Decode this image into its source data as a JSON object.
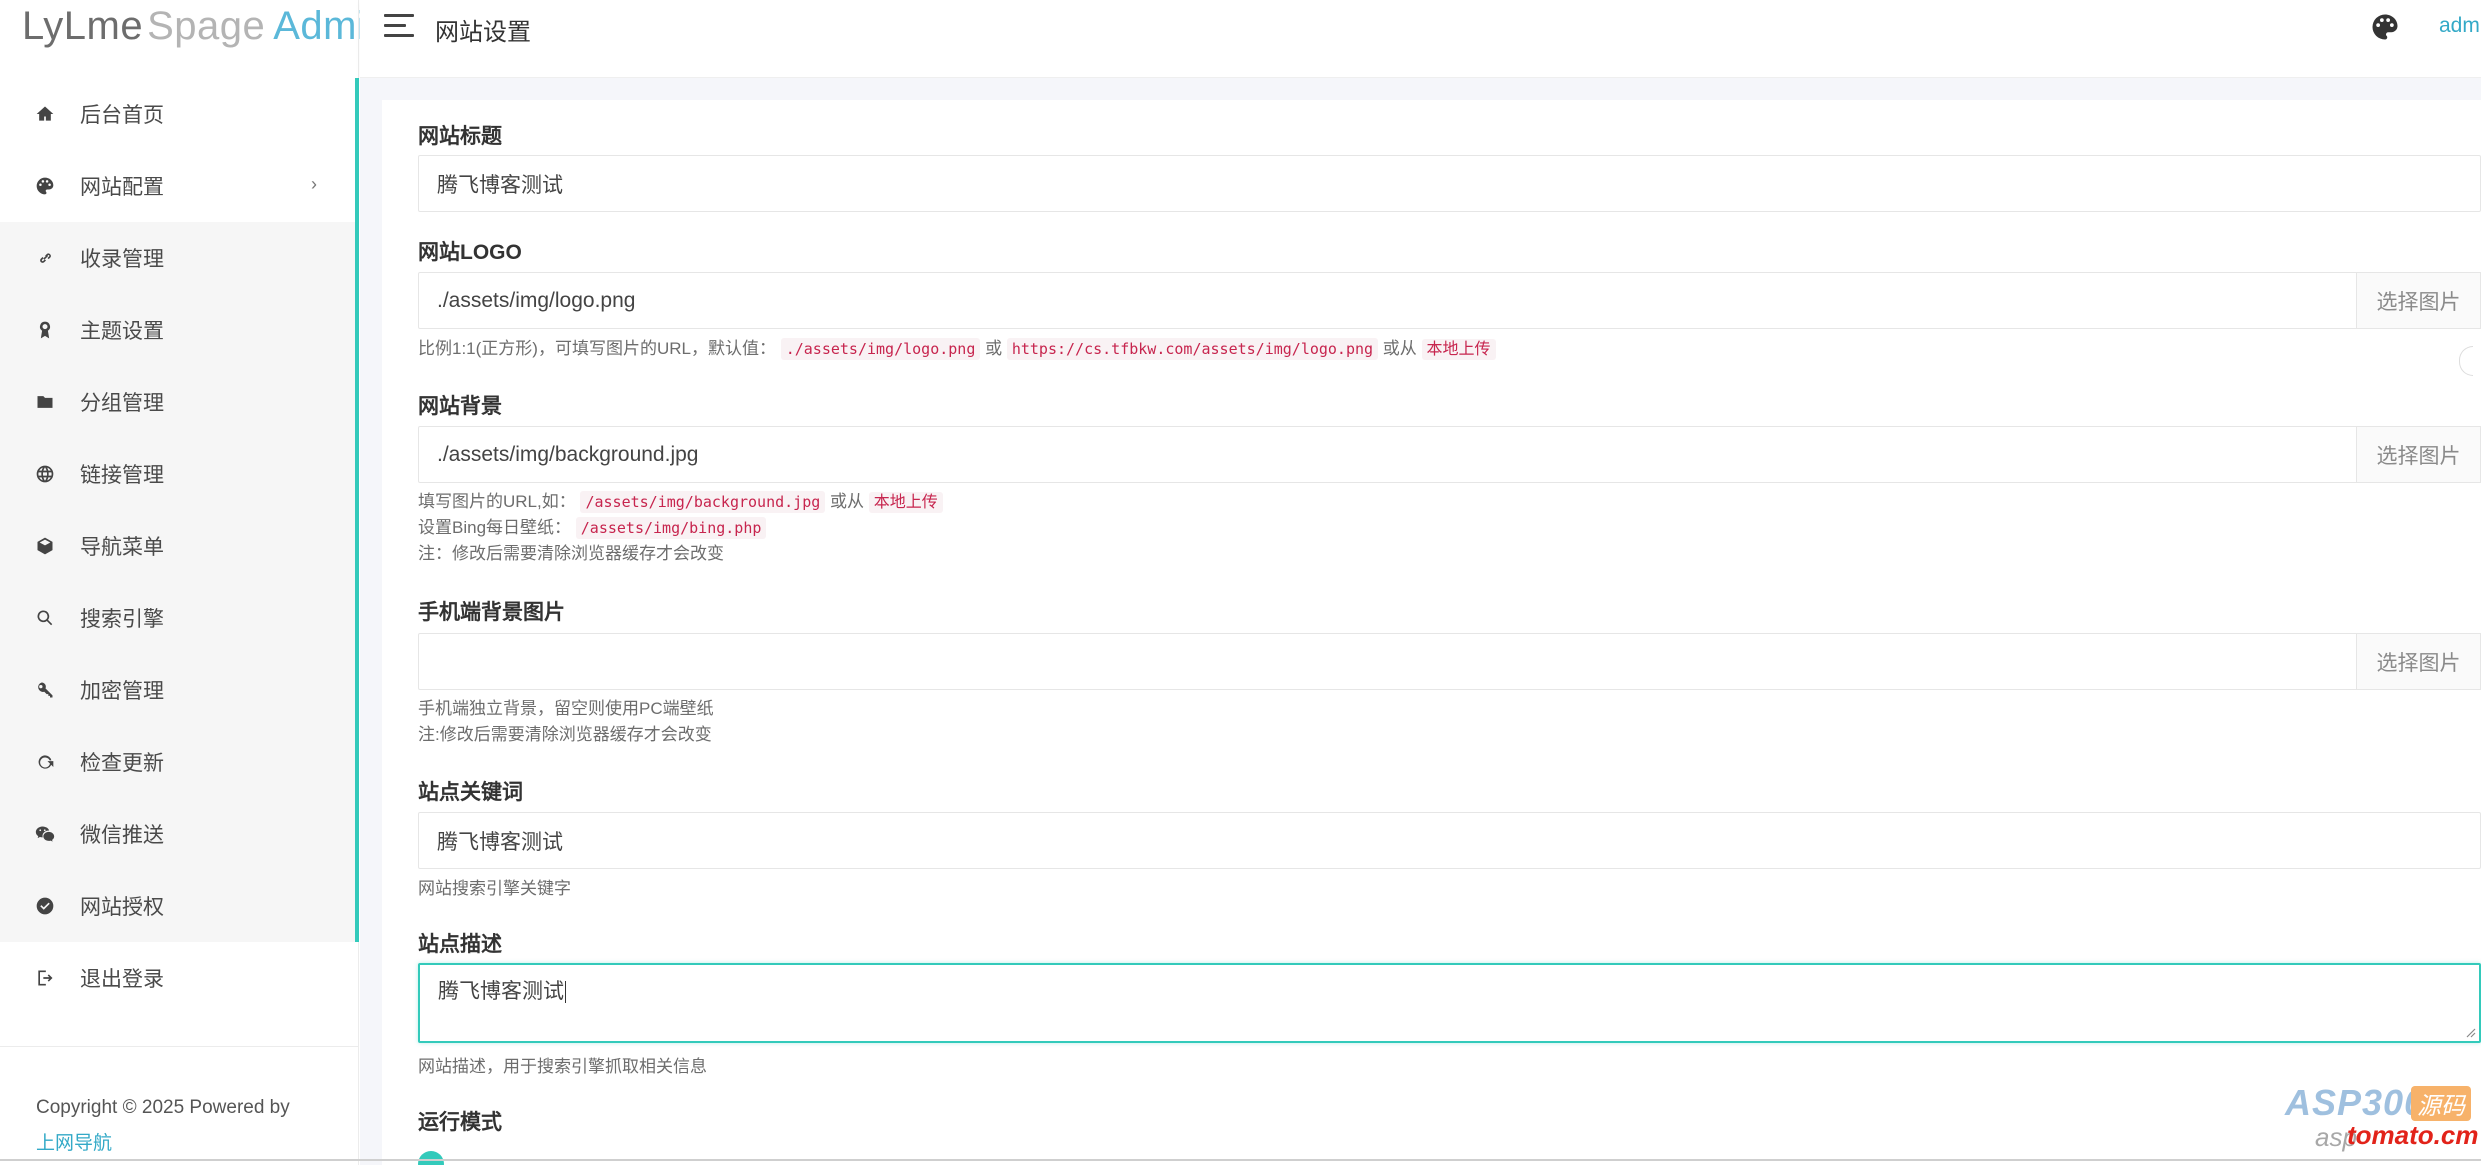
{
  "brand": {
    "part1": "LyLme",
    "part2": "Spage",
    "part3": "Admin"
  },
  "header": {
    "title": "网站设置",
    "user": "adm"
  },
  "sidebar": {
    "items": [
      {
        "label": "后台首页",
        "icon": "home-icon"
      },
      {
        "label": "网站配置",
        "icon": "palette-icon",
        "arrow": "›"
      },
      {
        "label": "收录管理",
        "icon": "link-icon"
      },
      {
        "label": "主题设置",
        "icon": "award-icon"
      },
      {
        "label": "分组管理",
        "icon": "folder-icon"
      },
      {
        "label": "链接管理",
        "icon": "globe-icon"
      },
      {
        "label": "导航菜单",
        "icon": "cube-icon"
      },
      {
        "label": "搜索引擎",
        "icon": "search-icon"
      },
      {
        "label": "加密管理",
        "icon": "key-icon"
      },
      {
        "label": "检查更新",
        "icon": "refresh-icon"
      },
      {
        "label": "微信推送",
        "icon": "wechat-icon"
      },
      {
        "label": "网站授权",
        "icon": "check-circle-icon"
      },
      {
        "label": "退出登录",
        "icon": "logout-icon"
      }
    ],
    "copyright": "Copyright © 2025 Powered by",
    "copyright_link": "上网导航"
  },
  "form": {
    "site_title": {
      "label": "网站标题",
      "value": "腾飞博客测试"
    },
    "site_logo": {
      "label": "网站LOGO",
      "value": "./assets/img/logo.png",
      "button": "选择图片",
      "help_prefix": "比例1:1(正方形)，可填写图片的URL，默认值：",
      "help_code1": "./assets/img/logo.png",
      "help_or": "或",
      "help_code2": "https://cs.tfbkw.com/assets/img/logo.png",
      "help_or2": "或从",
      "help_tag": "本地上传"
    },
    "site_bg": {
      "label": "网站背景",
      "value": "./assets/img/background.jpg",
      "button": "选择图片",
      "help1_prefix": "填写图片的URL,如：",
      "help1_code": "/assets/img/background.jpg",
      "help1_or": "或从",
      "help1_tag": "本地上传",
      "help2_prefix": "设置Bing每日壁纸：",
      "help2_code": "/assets/img/bing.php",
      "help3": "注：修改后需要清除浏览器缓存才会改变"
    },
    "mobile_bg": {
      "label": "手机端背景图片",
      "value": "",
      "button": "选择图片",
      "help1": "手机端独立背景，留空则使用PC端壁纸",
      "help2": "注:修改后需要清除浏览器缓存才会改变"
    },
    "keywords": {
      "label": "站点关键词",
      "value": "腾飞博客测试",
      "help": "网站搜索引擎关键字"
    },
    "description": {
      "label": "站点描述",
      "value": "腾飞博客测试",
      "help": "网站描述，用于搜索引擎抓取相关信息"
    },
    "run_mode": {
      "label": "运行模式"
    }
  },
  "watermark": {
    "brand": "ASP300",
    "badge": "源码",
    "domain_left": "asp",
    "domain_right": "tomato.cm"
  },
  "colors": {
    "accent": "#33cabb",
    "link": "#33a9c7",
    "code": "#c7254e"
  }
}
